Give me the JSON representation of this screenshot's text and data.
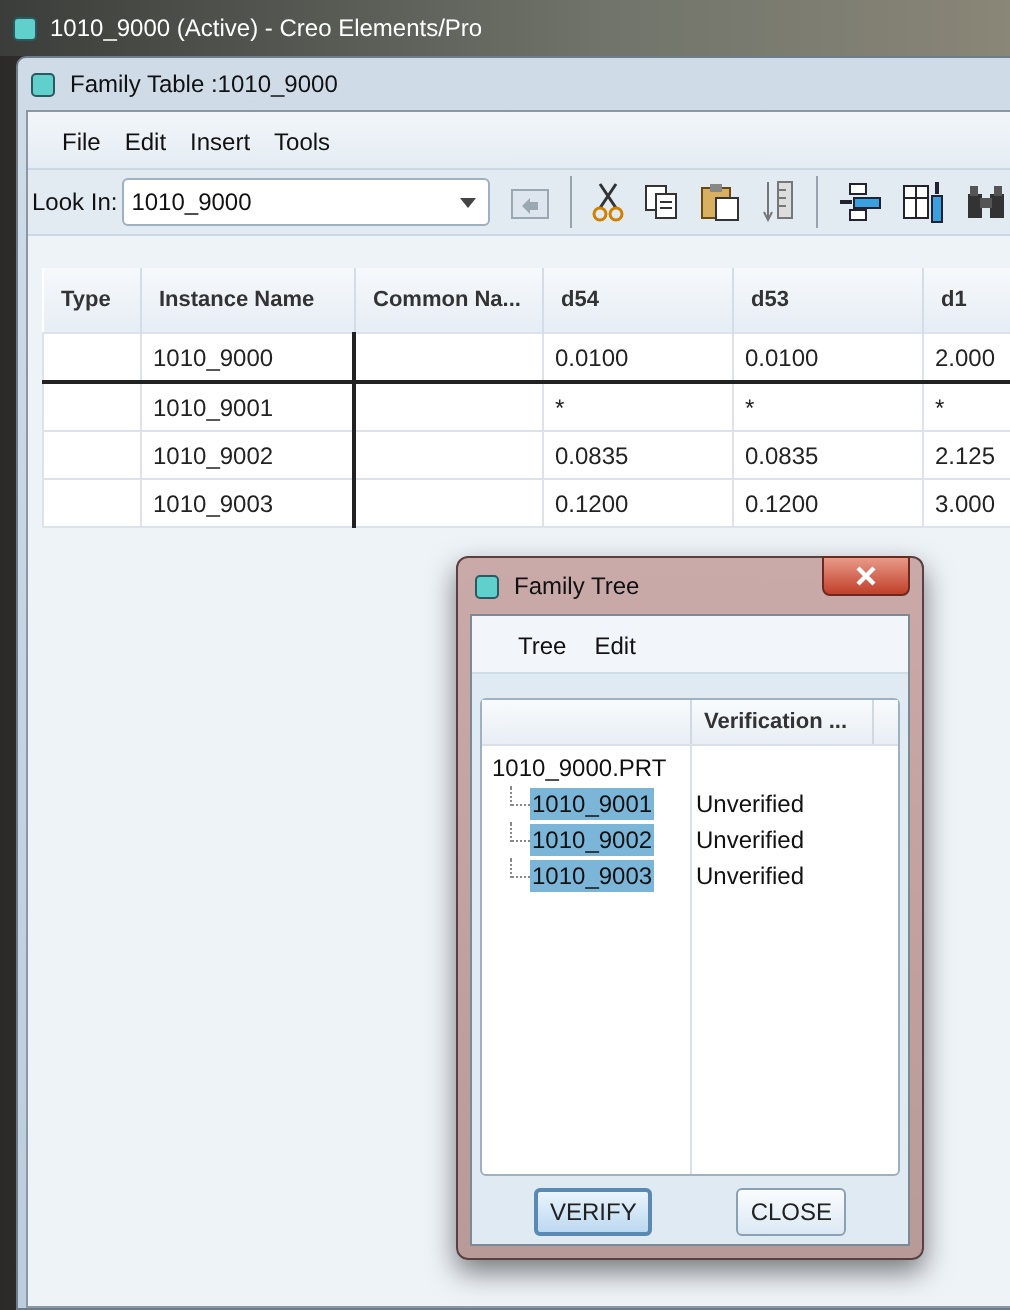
{
  "desktop_window": {
    "title": "1010_9000 (Active) - Creo Elements/Pro"
  },
  "family_table": {
    "title": "Family Table :1010_9000",
    "menu": [
      "File",
      "Edit",
      "Insert",
      "Tools"
    ],
    "look_in": {
      "label": "Look In:",
      "value": "1010_9000"
    },
    "table": {
      "columns": [
        "Type",
        "Instance Name",
        "Common Na...",
        "d54",
        "d53",
        "d1"
      ],
      "rows": [
        {
          "cells": [
            "",
            "1010_9000",
            "",
            "0.0100",
            "0.0100",
            "2.000"
          ]
        },
        {
          "cells": [
            "",
            "1010_9001",
            "",
            "*",
            "*",
            "*"
          ]
        },
        {
          "cells": [
            "",
            "1010_9002",
            "",
            "0.0835",
            "0.0835",
            "2.125"
          ]
        },
        {
          "cells": [
            "",
            "1010_9003",
            "",
            "0.1200",
            "0.1200",
            "3.000"
          ]
        }
      ]
    }
  },
  "family_tree": {
    "title": "Family Tree",
    "menu": [
      "Tree",
      "Edit"
    ],
    "column": "Verification ...",
    "root": {
      "label": "1010_9000.PRT",
      "children": [
        {
          "label": "1010_9001",
          "status": "Unverified",
          "selected": true
        },
        {
          "label": "1010_9002",
          "status": "Unverified",
          "selected": true
        },
        {
          "label": "1010_9003",
          "status": "Unverified",
          "selected": true
        }
      ]
    },
    "buttons": [
      {
        "label": "VERIFY",
        "focused": true
      },
      {
        "label": "CLOSE",
        "focused": false
      }
    ]
  }
}
